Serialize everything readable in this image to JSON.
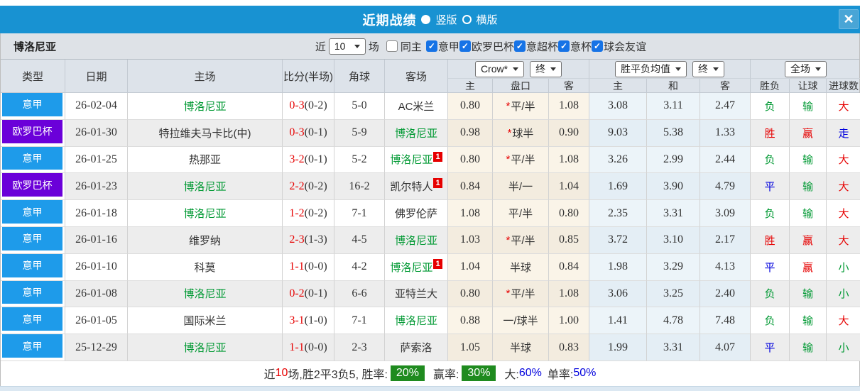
{
  "title_bar": {
    "title": "近期战绩",
    "layout_options": [
      {
        "label": "竖版",
        "selected": true
      },
      {
        "label": "横版",
        "selected": false
      }
    ],
    "close_icon": "✕"
  },
  "filter_bar": {
    "team_name": "博洛尼亚",
    "recent_label": "近",
    "recent_count": "10",
    "games_label": "场",
    "same_home": {
      "label": "同主",
      "checked": false
    },
    "competitions": [
      {
        "label": "意甲",
        "checked": true
      },
      {
        "label": "欧罗巴杯",
        "checked": true
      },
      {
        "label": "意超杯",
        "checked": true
      },
      {
        "label": "意杯",
        "checked": true
      },
      {
        "label": "球会友谊",
        "checked": true
      }
    ]
  },
  "table": {
    "main_headers": [
      "类型",
      "日期",
      "主场",
      "比分(半场)",
      "角球",
      "客场"
    ],
    "odds_group": {
      "bookmaker_select": "Crow*",
      "state_select": "终",
      "sub_headers": [
        "主",
        "盘口",
        "客"
      ]
    },
    "avg_group": {
      "metric_select": "胜平负均值",
      "state_select": "终",
      "sub_headers": [
        "主",
        "和",
        "客"
      ]
    },
    "result_group": {
      "scope_select": "全场",
      "sub_headers": [
        "胜负",
        "让球",
        "进球数"
      ]
    },
    "rows": [
      {
        "league": "意甲",
        "league_key": "serie-a",
        "date": "26-02-04",
        "home": {
          "name": "博洛尼亚",
          "highlight": true,
          "badge": ""
        },
        "score": "0-3",
        "half": "(0-2)",
        "corner": "5-0",
        "away": {
          "name": "AC米兰",
          "highlight": false,
          "badge": ""
        },
        "odds_home": "0.80",
        "line": "平/半",
        "line_star": true,
        "odds_away": "1.08",
        "avg_home": "3.08",
        "avg_draw": "3.11",
        "avg_away": "2.47",
        "res_wdl": {
          "t": "负",
          "c": "green"
        },
        "res_handicap": {
          "t": "输",
          "c": "green"
        },
        "res_goals": {
          "t": "大",
          "c": "red"
        }
      },
      {
        "league": "欧罗巴杯",
        "league_key": "europa",
        "date": "26-01-30",
        "home": {
          "name": "特拉维夫马卡比(中)",
          "highlight": false,
          "badge": ""
        },
        "score": "0-3",
        "half": "(0-1)",
        "corner": "5-9",
        "away": {
          "name": "博洛尼亚",
          "highlight": true,
          "badge": ""
        },
        "odds_home": "0.98",
        "line": "球半",
        "line_star": true,
        "odds_away": "0.90",
        "avg_home": "9.03",
        "avg_draw": "5.38",
        "avg_away": "1.33",
        "res_wdl": {
          "t": "胜",
          "c": "red"
        },
        "res_handicap": {
          "t": "赢",
          "c": "red"
        },
        "res_goals": {
          "t": "走",
          "c": "blue"
        }
      },
      {
        "league": "意甲",
        "league_key": "serie-a",
        "date": "26-01-25",
        "home": {
          "name": "热那亚",
          "highlight": false,
          "badge": ""
        },
        "score": "3-2",
        "half": "(0-1)",
        "corner": "5-2",
        "away": {
          "name": "博洛尼亚",
          "highlight": true,
          "badge": "1"
        },
        "odds_home": "0.80",
        "line": "平/半",
        "line_star": true,
        "odds_away": "1.08",
        "avg_home": "3.26",
        "avg_draw": "2.99",
        "avg_away": "2.44",
        "res_wdl": {
          "t": "负",
          "c": "green"
        },
        "res_handicap": {
          "t": "输",
          "c": "green"
        },
        "res_goals": {
          "t": "大",
          "c": "red"
        }
      },
      {
        "league": "欧罗巴杯",
        "league_key": "europa",
        "date": "26-01-23",
        "home": {
          "name": "博洛尼亚",
          "highlight": true,
          "badge": ""
        },
        "score": "2-2",
        "half": "(0-2)",
        "corner": "16-2",
        "away": {
          "name": "凯尔特人",
          "highlight": false,
          "badge": "1"
        },
        "odds_home": "0.84",
        "line": "半/一",
        "line_star": false,
        "odds_away": "1.04",
        "avg_home": "1.69",
        "avg_draw": "3.90",
        "avg_away": "4.79",
        "res_wdl": {
          "t": "平",
          "c": "blue"
        },
        "res_handicap": {
          "t": "输",
          "c": "green"
        },
        "res_goals": {
          "t": "大",
          "c": "red"
        }
      },
      {
        "league": "意甲",
        "league_key": "serie-a",
        "date": "26-01-18",
        "home": {
          "name": "博洛尼亚",
          "highlight": true,
          "badge": ""
        },
        "score": "1-2",
        "half": "(0-2)",
        "corner": "7-1",
        "away": {
          "name": "佛罗伦萨",
          "highlight": false,
          "badge": ""
        },
        "odds_home": "1.08",
        "line": "平/半",
        "line_star": false,
        "odds_away": "0.80",
        "avg_home": "2.35",
        "avg_draw": "3.31",
        "avg_away": "3.09",
        "res_wdl": {
          "t": "负",
          "c": "green"
        },
        "res_handicap": {
          "t": "输",
          "c": "green"
        },
        "res_goals": {
          "t": "大",
          "c": "red"
        }
      },
      {
        "league": "意甲",
        "league_key": "serie-a",
        "date": "26-01-16",
        "home": {
          "name": "维罗纳",
          "highlight": false,
          "badge": ""
        },
        "score": "2-3",
        "half": "(1-3)",
        "corner": "4-5",
        "away": {
          "name": "博洛尼亚",
          "highlight": true,
          "badge": ""
        },
        "odds_home": "1.03",
        "line": "平/半",
        "line_star": true,
        "odds_away": "0.85",
        "avg_home": "3.72",
        "avg_draw": "3.10",
        "avg_away": "2.17",
        "res_wdl": {
          "t": "胜",
          "c": "red"
        },
        "res_handicap": {
          "t": "赢",
          "c": "red"
        },
        "res_goals": {
          "t": "大",
          "c": "red"
        }
      },
      {
        "league": "意甲",
        "league_key": "serie-a",
        "date": "26-01-10",
        "home": {
          "name": "科莫",
          "highlight": false,
          "badge": ""
        },
        "score": "1-1",
        "half": "(0-0)",
        "corner": "4-2",
        "away": {
          "name": "博洛尼亚",
          "highlight": true,
          "badge": "1"
        },
        "odds_home": "1.04",
        "line": "半球",
        "line_star": false,
        "odds_away": "0.84",
        "avg_home": "1.98",
        "avg_draw": "3.29",
        "avg_away": "4.13",
        "res_wdl": {
          "t": "平",
          "c": "blue"
        },
        "res_handicap": {
          "t": "赢",
          "c": "red"
        },
        "res_goals": {
          "t": "小",
          "c": "green"
        }
      },
      {
        "league": "意甲",
        "league_key": "serie-a",
        "date": "26-01-08",
        "home": {
          "name": "博洛尼亚",
          "highlight": true,
          "badge": ""
        },
        "score": "0-2",
        "half": "(0-1)",
        "corner": "6-6",
        "away": {
          "name": "亚特兰大",
          "highlight": false,
          "badge": ""
        },
        "odds_home": "0.80",
        "line": "平/半",
        "line_star": true,
        "odds_away": "1.08",
        "avg_home": "3.06",
        "avg_draw": "3.25",
        "avg_away": "2.40",
        "res_wdl": {
          "t": "负",
          "c": "green"
        },
        "res_handicap": {
          "t": "输",
          "c": "green"
        },
        "res_goals": {
          "t": "小",
          "c": "green"
        }
      },
      {
        "league": "意甲",
        "league_key": "serie-a",
        "date": "26-01-05",
        "home": {
          "name": "国际米兰",
          "highlight": false,
          "badge": ""
        },
        "score": "3-1",
        "half": "(1-0)",
        "corner": "7-1",
        "away": {
          "name": "博洛尼亚",
          "highlight": true,
          "badge": ""
        },
        "odds_home": "0.88",
        "line": "一/球半",
        "line_star": false,
        "odds_away": "1.00",
        "avg_home": "1.41",
        "avg_draw": "4.78",
        "avg_away": "7.48",
        "res_wdl": {
          "t": "负",
          "c": "green"
        },
        "res_handicap": {
          "t": "输",
          "c": "green"
        },
        "res_goals": {
          "t": "大",
          "c": "red"
        }
      },
      {
        "league": "意甲",
        "league_key": "serie-a",
        "date": "25-12-29",
        "home": {
          "name": "博洛尼亚",
          "highlight": true,
          "badge": ""
        },
        "score": "1-1",
        "half": "(0-0)",
        "corner": "2-3",
        "away": {
          "name": "萨索洛",
          "highlight": false,
          "badge": ""
        },
        "odds_home": "1.05",
        "line": "半球",
        "line_star": false,
        "odds_away": "0.83",
        "avg_home": "1.99",
        "avg_draw": "3.31",
        "avg_away": "4.07",
        "res_wdl": {
          "t": "平",
          "c": "blue"
        },
        "res_handicap": {
          "t": "输",
          "c": "green"
        },
        "res_goals": {
          "t": "小",
          "c": "green"
        }
      }
    ]
  },
  "footer": {
    "segments": [
      {
        "text": "近",
        "style": "plain"
      },
      {
        "text": "10",
        "style": "red"
      },
      {
        "text": "场,胜2平3负5, 胜率:",
        "style": "plain"
      },
      {
        "text": "20%",
        "style": "green-badge"
      },
      {
        "text": "赢率:",
        "style": "plain"
      },
      {
        "text": "30%",
        "style": "green-badge"
      },
      {
        "text": "大:",
        "style": "plain"
      },
      {
        "text": "60%",
        "style": "blue"
      },
      {
        "text": "单率:",
        "style": "plain"
      },
      {
        "text": "50%",
        "style": "blue"
      }
    ]
  },
  "colors": {
    "title_bar_bg": "#1892d2",
    "serie_a_badge_bg": "#1e9bea",
    "europa_badge_bg": "#6b00d9",
    "team_highlight_green": "#009933",
    "win_red": "#e60000",
    "draw_blue": "#0000dd",
    "rate_badge_green_bg": "#1f8b1f"
  }
}
